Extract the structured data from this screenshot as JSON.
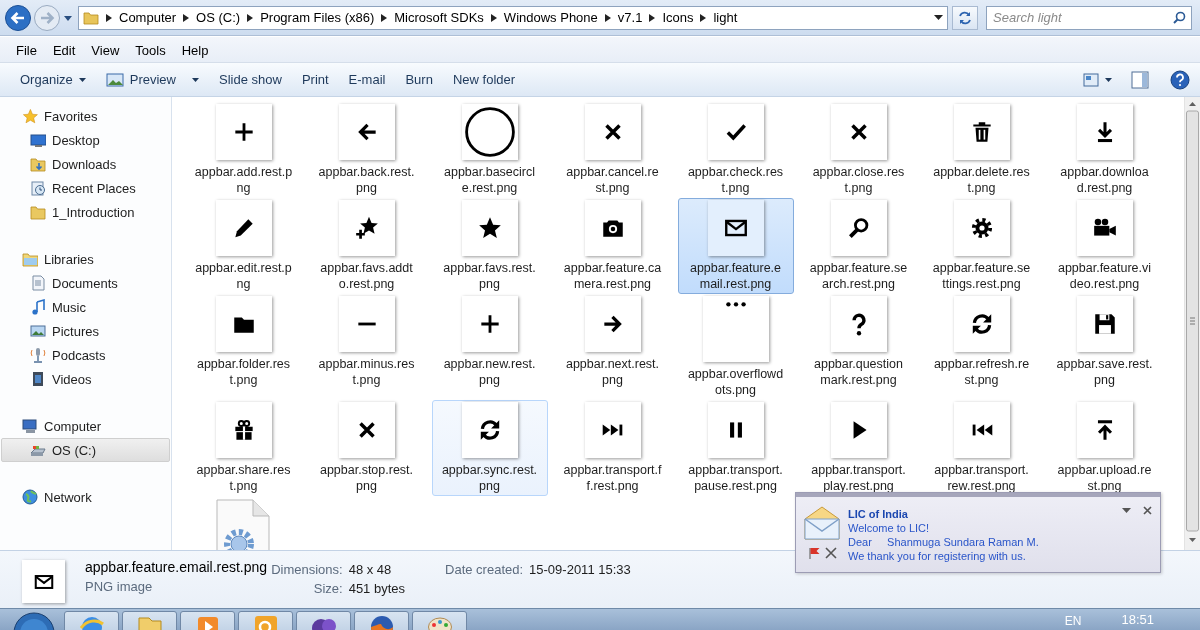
{
  "address_bar": {
    "path": [
      "Computer",
      "OS (C:)",
      "Program Files (x86)",
      "Microsoft SDKs",
      "Windows Phone",
      "v7.1",
      "Icons",
      "light"
    ],
    "search": {
      "placeholder": "Search light"
    }
  },
  "menu_bar": [
    "File",
    "Edit",
    "View",
    "Tools",
    "Help"
  ],
  "toolbar": [
    {
      "label": "Organize",
      "kind": "menu"
    },
    {
      "label": "Preview",
      "kind": "split"
    },
    {
      "label": "Slide show",
      "kind": "plain"
    },
    {
      "label": "Print",
      "kind": "plain"
    },
    {
      "label": "E-mail",
      "kind": "plain"
    },
    {
      "label": "Burn",
      "kind": "plain"
    },
    {
      "label": "New folder",
      "kind": "plain"
    }
  ],
  "sidebar": [
    {
      "label": "Favorites",
      "kind": "star",
      "selected": false,
      "children": [
        {
          "label": "Desktop",
          "kind": "desktop",
          "selected": false
        },
        {
          "label": "Downloads",
          "kind": "downloads",
          "selected": false
        },
        {
          "label": "Recent Places",
          "kind": "recent",
          "selected": false
        },
        {
          "label": "1_Introduction",
          "kind": "folder",
          "selected": false
        }
      ]
    },
    {
      "label": "Libraries",
      "kind": "libraries",
      "selected": false,
      "children": [
        {
          "label": "Documents",
          "kind": "documents",
          "selected": false
        },
        {
          "label": "Music",
          "kind": "music",
          "selected": false
        },
        {
          "label": "Pictures",
          "kind": "pictures",
          "selected": false
        },
        {
          "label": "Podcasts",
          "kind": "podcasts",
          "selected": false
        },
        {
          "label": "Videos",
          "kind": "videos",
          "selected": false
        }
      ]
    },
    {
      "label": "Computer",
      "kind": "computer",
      "selected": false,
      "children": [
        {
          "label": "OS (C:)",
          "kind": "drive",
          "selected": true
        }
      ]
    },
    {
      "label": "Network",
      "kind": "network",
      "selected": false
    }
  ],
  "files": [
    {
      "name": "appbar.add.rest.png",
      "kind": "plus",
      "selected": false,
      "hovered": false
    },
    {
      "name": "appbar.back.rest.png",
      "kind": "left-arrow",
      "selected": false,
      "hovered": false
    },
    {
      "name": "appbar.basecircle.rest.png",
      "kind": "circle",
      "selected": false,
      "hovered": false
    },
    {
      "name": "appbar.cancel.rest.png",
      "kind": "cross",
      "selected": false,
      "hovered": false
    },
    {
      "name": "appbar.check.rest.png",
      "kind": "check",
      "selected": false,
      "hovered": false
    },
    {
      "name": "appbar.close.rest.png",
      "kind": "cross",
      "selected": false,
      "hovered": false
    },
    {
      "name": "appbar.delete.rest.png",
      "kind": "trash",
      "selected": false,
      "hovered": false
    },
    {
      "name": "appbar.download.rest.png",
      "kind": "download",
      "selected": false,
      "hovered": false
    },
    {
      "name": "appbar.edit.rest.png",
      "kind": "pencil",
      "selected": false,
      "hovered": false
    },
    {
      "name": "appbar.favs.addto.rest.png",
      "kind": "star-plus",
      "selected": false,
      "hovered": false
    },
    {
      "name": "appbar.favs.rest.png",
      "kind": "star",
      "selected": false,
      "hovered": false
    },
    {
      "name": "appbar.feature.camera.rest.png",
      "kind": "camera",
      "selected": false,
      "hovered": false
    },
    {
      "name": "appbar.feature.email.rest.png",
      "kind": "envelope",
      "selected": true,
      "hovered": false
    },
    {
      "name": "appbar.feature.search.rest.png",
      "kind": "search",
      "selected": false,
      "hovered": false
    },
    {
      "name": "appbar.feature.settings.rest.png",
      "kind": "gear",
      "selected": false,
      "hovered": false
    },
    {
      "name": "appbar.feature.video.rest.png",
      "kind": "video-camera",
      "selected": false,
      "hovered": false
    },
    {
      "name": "appbar.folder.rest.png",
      "kind": "folder",
      "selected": false,
      "hovered": false
    },
    {
      "name": "appbar.minus.rest.png",
      "kind": "minus",
      "selected": false,
      "hovered": false
    },
    {
      "name": "appbar.new.rest.png",
      "kind": "plus",
      "selected": false,
      "hovered": false
    },
    {
      "name": "appbar.next.rest.png",
      "kind": "right-arrow",
      "selected": false,
      "hovered": false
    },
    {
      "name": "appbar.overflowdots.png",
      "kind": "dots",
      "selected": false,
      "hovered": false
    },
    {
      "name": "appbar.questionmark.rest.png",
      "kind": "question-mark",
      "selected": false,
      "hovered": false
    },
    {
      "name": "appbar.refresh.rest.png",
      "kind": "refresh",
      "selected": false,
      "hovered": false
    },
    {
      "name": "appbar.save.rest.png",
      "kind": "floppy-disk",
      "selected": false,
      "hovered": false
    },
    {
      "name": "appbar.share.rest.png",
      "kind": "gift",
      "selected": false,
      "hovered": false
    },
    {
      "name": "appbar.stop.rest.png",
      "kind": "cross",
      "selected": false,
      "hovered": false
    },
    {
      "name": "appbar.sync.rest.png",
      "kind": "refresh",
      "selected": false,
      "hovered": true
    },
    {
      "name": "appbar.transport.ff.rest.png",
      "kind": "fast-forward",
      "selected": false,
      "hovered": false
    },
    {
      "name": "appbar.transport.pause.rest.png",
      "kind": "pause",
      "selected": false,
      "hovered": false
    },
    {
      "name": "appbar.transport.play.rest.png",
      "kind": "play",
      "selected": false,
      "hovered": false
    },
    {
      "name": "appbar.transport.rew.rest.png",
      "kind": "rewind",
      "selected": false,
      "hovered": false
    },
    {
      "name": "appbar.upload.rest.png",
      "kind": "upload",
      "selected": false,
      "hovered": false
    },
    {
      "kind": "file",
      "selected": false,
      "hovered": false
    }
  ],
  "details": {
    "name": "appbar.feature.email.rest.png",
    "kind": "envelope",
    "type": "PNG image",
    "fields": [
      {
        "label": "Dimensions:",
        "value": "48 x 48"
      },
      {
        "label": "Size:",
        "value": "451 bytes"
      },
      {
        "label": "Date created:",
        "value": "15-09-2011 15:33"
      }
    ]
  },
  "notification": {
    "title": "LIC of India",
    "lines": [
      "Welcome to LIC!",
      "Dear     Shanmuga Sundara Raman M.",
      "We thank you for registering with us."
    ]
  },
  "taskbar": {
    "buttons": [
      {
        "kind": "globe"
      },
      {
        "kind": "folder"
      },
      {
        "kind": "media"
      },
      {
        "kind": "mail"
      },
      {
        "kind": "app"
      },
      {
        "kind": "fox"
      },
      {
        "kind": "paint"
      }
    ],
    "language": "EN",
    "clock": "18:51"
  }
}
